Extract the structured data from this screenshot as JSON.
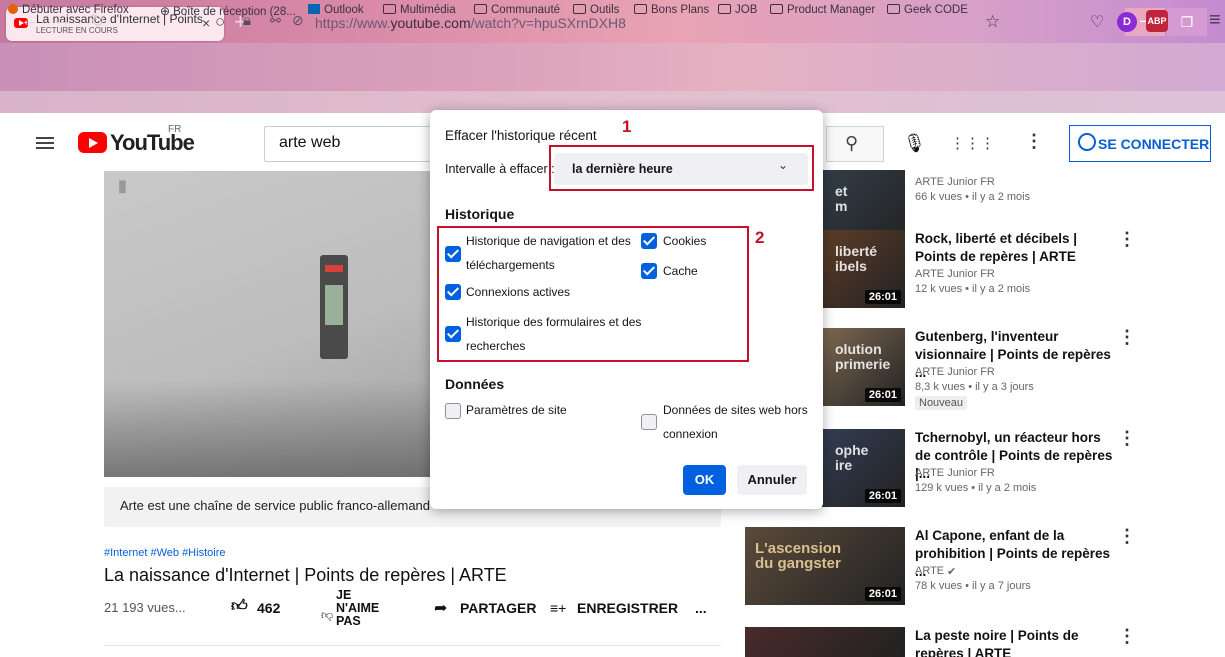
{
  "browser": {
    "tab": {
      "title": "La naissance d'Internet | Points",
      "subtitle": "LECTURE EN COURS",
      "close": "×"
    },
    "new_tab": "+",
    "window": {
      "minimize": "–",
      "maximize": "❐"
    },
    "url_prefix": "https://www.",
    "url_domain": "youtube.com",
    "url_path": "/watch?v=hpuSXrnDXH8",
    "bookmarks": [
      "Débuter avec Firefox",
      "Boîte de réception (28...",
      "Outlook",
      "Multimédia",
      "Communauté",
      "Outils",
      "Bons Plans",
      "JOB",
      "Product Manager",
      "Geek CODE"
    ]
  },
  "youtube": {
    "logo_text": "YouTube",
    "logo_region": "FR",
    "search_value": "arte web",
    "sign_in": "SE CONNECTER",
    "video": {
      "description": "Arte est une chaîne de service public franco-allemande",
      "hashtags": "#Internet #Web #Histoire",
      "title": "La naissance d'Internet | Points de repères | ARTE",
      "views": "21 193 vues...",
      "likes": "462",
      "dislike_label": "JE N'AIME PAS",
      "share_label": "PARTAGER",
      "save_label": "ENREGISTRER",
      "more": "..."
    },
    "sidebar": [
      {
        "title": "",
        "channel": "ARTE Junior FR",
        "meta": "66 k vues • il y a 2 mois",
        "duration": "26:01",
        "thumb_text": "et\nm",
        "color": "#3b4a5a"
      },
      {
        "title": "Rock, liberté et décibels | Points de repères | ARTE",
        "channel": "ARTE Junior FR",
        "meta": "12 k vues • il y a 2 mois",
        "duration": "26:01",
        "thumb_text": "liberté\nibels",
        "color": "#7a4a2a"
      },
      {
        "title": "Gutenberg, l'inventeur visionnaire | Points de repères ...",
        "channel": "ARTE Junior FR",
        "meta": "8,3 k vues • il y a 3 jours",
        "badge": "Nouveau",
        "duration": "26:01",
        "thumb_text": "olution\nprimerie",
        "color": "#a88a6a"
      },
      {
        "title": "Tchernobyl, un réacteur hors de contrôle | Points de repères |...",
        "channel": "ARTE Junior FR",
        "meta": "129 k vues • il y a 2 mois",
        "duration": "26:01",
        "thumb_text": "ophe\nire",
        "color": "#3a4a6a"
      },
      {
        "title": "Al Capone, enfant de la prohibition | Points de repères ...",
        "channel": "ARTE",
        "meta": "78 k vues • il y a 7 jours",
        "duration": "26:01",
        "thumb_text": "L'ascension\ndu gangster",
        "color": "#5a4a3a"
      },
      {
        "title": "La peste noire | Points de repères | ARTE",
        "channel": "",
        "meta": "",
        "duration": "",
        "thumb_text": "",
        "color": "#4a2a2a"
      }
    ]
  },
  "dialog": {
    "title": "Effacer l'historique récent",
    "range_label": "Intervalle à effacer :",
    "range_value": "la dernière heure",
    "history_heading": "Historique",
    "history_items": [
      {
        "label": "Historique de navigation et des téléchargements",
        "checked": true
      },
      {
        "label": "Connexions actives",
        "checked": true
      },
      {
        "label": "Historique des formulaires et des recherches",
        "checked": true
      },
      {
        "label": "Cookies",
        "checked": true
      },
      {
        "label": "Cache",
        "checked": true
      }
    ],
    "data_heading": "Données",
    "data_items": [
      {
        "label": "Paramètres de site",
        "checked": false
      },
      {
        "label": "Données de sites web hors connexion",
        "checked": false
      }
    ],
    "ok": "OK",
    "cancel": "Annuler"
  },
  "annotations": {
    "box1": "1",
    "box2": "2",
    "color": "#c8102e"
  }
}
